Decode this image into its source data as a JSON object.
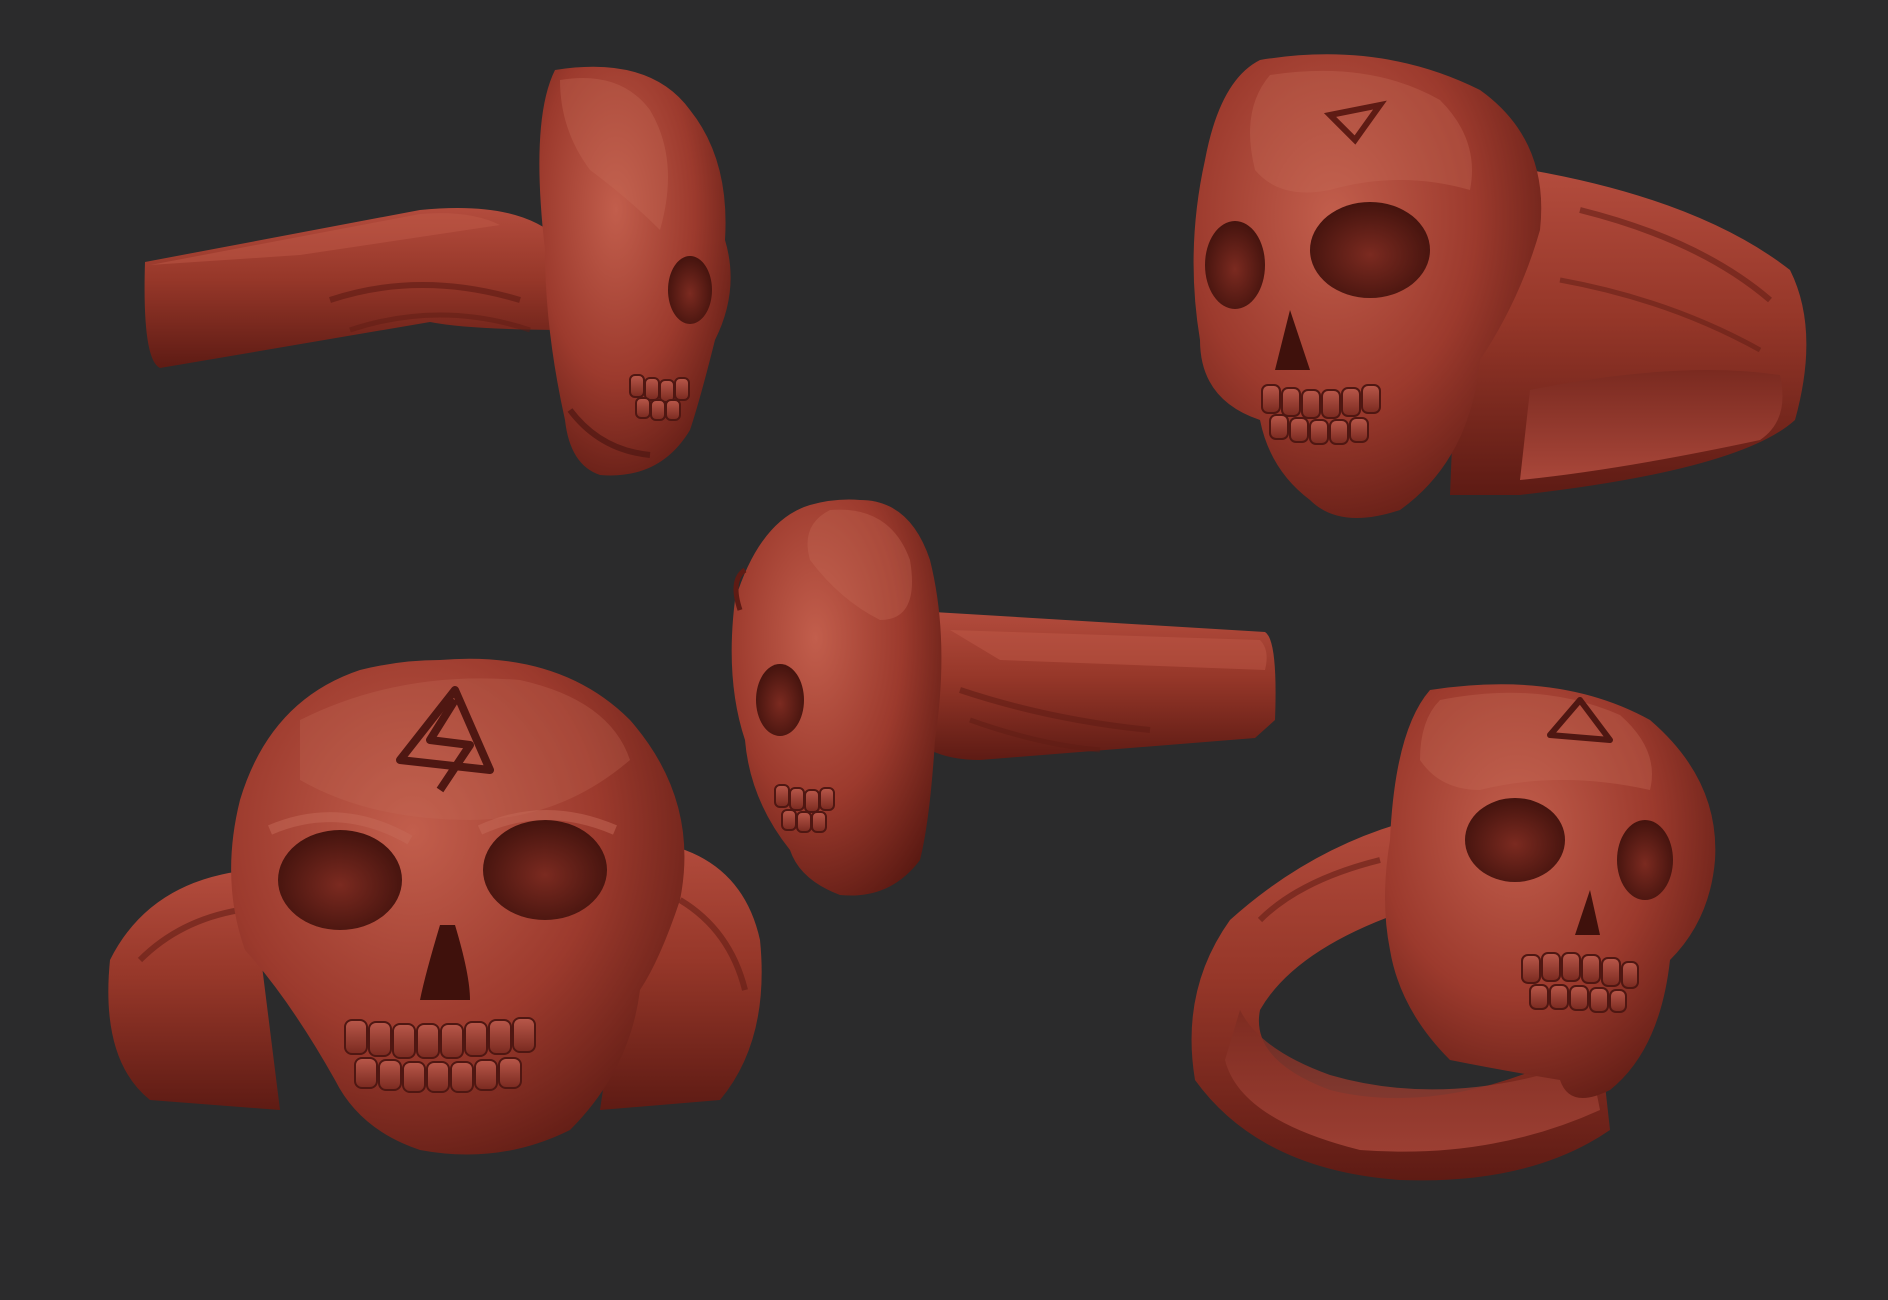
{
  "scene": {
    "background": "#2b2b2c",
    "material": {
      "base": "#9a3a2e",
      "mid": "#7e2c22",
      "shadow": "#4f1712",
      "deep": "#3a100c",
      "highlight": "#c2604f",
      "specular": "#d9806c"
    },
    "views": [
      {
        "id": "side-left",
        "subject": "skull-ring",
        "facing": "right"
      },
      {
        "id": "three-quarter-left",
        "subject": "skull-ring",
        "facing": "left"
      },
      {
        "id": "side-right",
        "subject": "skull-ring",
        "facing": "left"
      },
      {
        "id": "front",
        "subject": "skull-ring",
        "facing": "front"
      },
      {
        "id": "three-quarter-right",
        "subject": "skull-ring",
        "facing": "right"
      }
    ]
  }
}
